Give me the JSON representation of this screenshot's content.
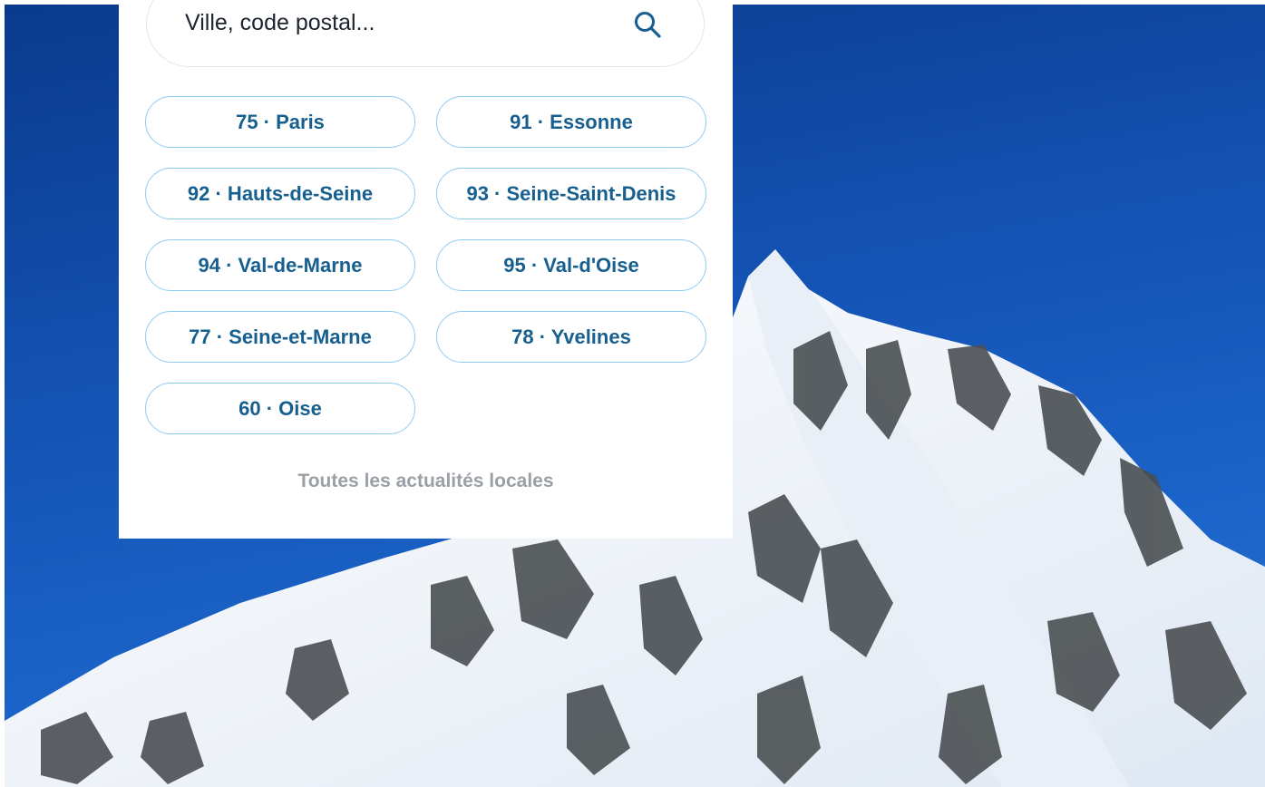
{
  "search": {
    "placeholder": "Ville, code postal..."
  },
  "departments": [
    {
      "label": "75 · Paris"
    },
    {
      "label": "91 · Essonne"
    },
    {
      "label": "92 · Hauts-de-Seine"
    },
    {
      "label": "93 · Seine-Saint-Denis"
    },
    {
      "label": "94 · Val-de-Marne"
    },
    {
      "label": "95 · Val-d'Oise"
    },
    {
      "label": "77 · Seine-et-Marne"
    },
    {
      "label": "78 · Yvelines"
    },
    {
      "label": "60 · Oise"
    }
  ],
  "footer_link": "Toutes les actualités locales",
  "colors": {
    "chip_text": "#175f8f",
    "chip_border": "#8ecdf3",
    "sky": "#1452b3",
    "muted_link": "#9aa0a6"
  },
  "icons": {
    "search": "search-icon"
  }
}
